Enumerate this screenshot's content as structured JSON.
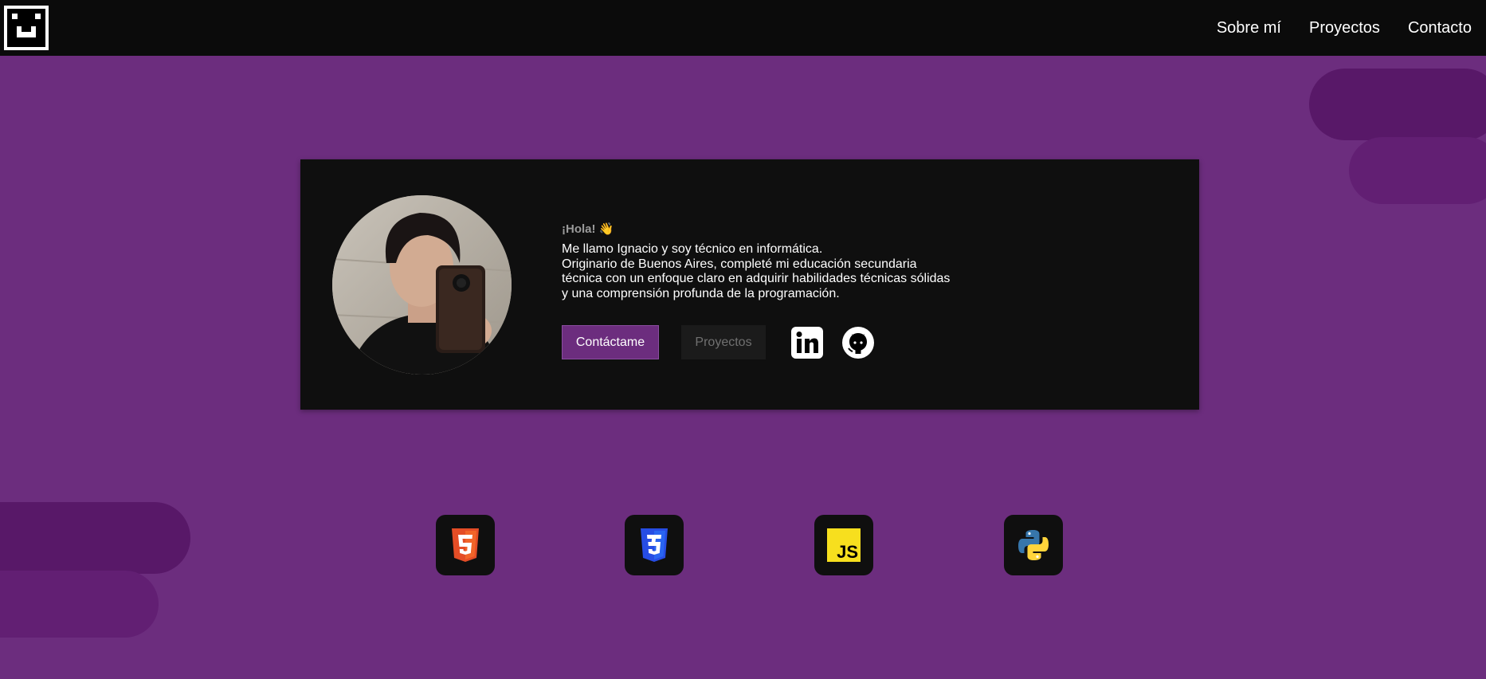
{
  "header": {
    "logo_icon": "pixel-face-logo-icon",
    "nav": [
      {
        "label": "Sobre mí"
      },
      {
        "label": "Proyectos"
      },
      {
        "label": "Contacto"
      }
    ]
  },
  "hero": {
    "greeting": "¡Hola! 👋",
    "bio_lines": [
      "Me llamo Ignacio y soy técnico en informática.",
      "Originario de Buenos Aires, completé mi educación secundaria",
      "técnica con un enfoque claro en adquirir habilidades técnicas sólidas",
      "y una comprensión profunda de la programación."
    ],
    "contact_button": "Contáctame",
    "projects_button": "Proyectos",
    "social": [
      {
        "icon": "linkedin-icon"
      },
      {
        "icon": "github-icon"
      }
    ]
  },
  "skills": [
    {
      "icon": "html5-icon"
    },
    {
      "icon": "css3-icon"
    },
    {
      "icon": "javascript-icon",
      "text": "JS"
    },
    {
      "icon": "python-icon"
    }
  ],
  "colors": {
    "background": "#6c2d7e",
    "header": "#0b0b0b",
    "card": "#0f0f0f",
    "accent": "#6c2d7e",
    "pill_dark": "#581868",
    "pill_mid": "#621f73",
    "html5": "#e44d26",
    "css3": "#264de4",
    "javascript": "#f7df1e",
    "python_blue": "#3776ab",
    "python_yellow": "#ffd43b"
  }
}
